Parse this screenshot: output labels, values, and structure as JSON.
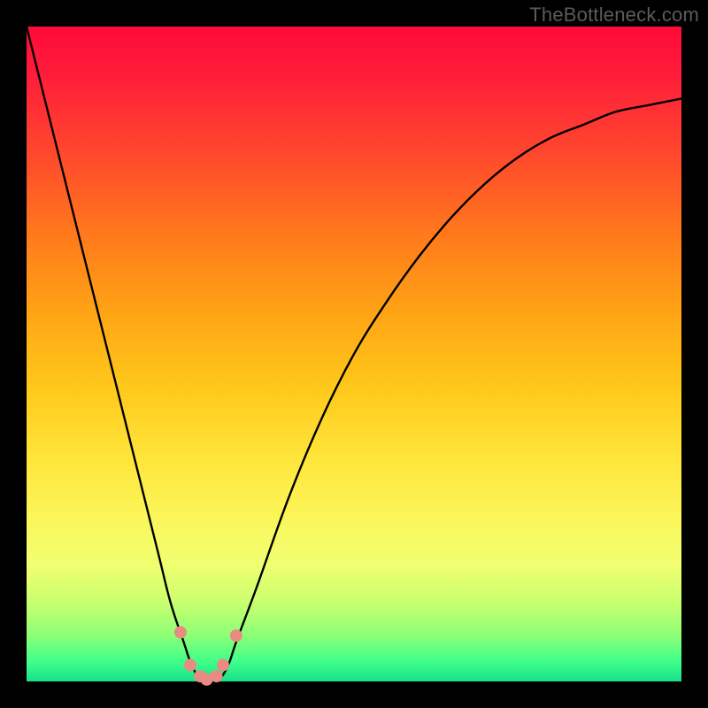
{
  "watermark": "TheBottleneck.com",
  "chart_data": {
    "type": "line",
    "title": "",
    "xlabel": "",
    "ylabel": "",
    "xlim": [
      0,
      100
    ],
    "ylim": [
      0,
      100
    ],
    "x": [
      0,
      5,
      10,
      15,
      20,
      22,
      24,
      25,
      26,
      27,
      28,
      29,
      30,
      31,
      32,
      35,
      40,
      45,
      50,
      55,
      60,
      65,
      70,
      75,
      80,
      85,
      90,
      95,
      100
    ],
    "values": [
      100,
      80,
      60,
      40,
      20,
      12,
      6,
      3,
      1,
      0,
      0,
      0,
      1,
      3,
      6,
      14,
      28,
      40,
      50,
      58,
      65,
      71,
      76,
      80,
      83,
      85,
      87,
      88,
      89
    ],
    "minimum_x": 27.5,
    "marker_points_x": [
      23.5,
      25.0,
      26.5,
      27.5,
      29.0,
      30.0,
      32.0
    ],
    "marker_points_y": [
      7.5,
      2.5,
      0.8,
      0.3,
      0.8,
      2.5,
      7.0
    ],
    "gradient_stops": [
      {
        "pos": 0.0,
        "color": "#ff0a3a"
      },
      {
        "pos": 0.5,
        "color": "#ffc81a"
      },
      {
        "pos": 0.8,
        "color": "#f1ff70"
      },
      {
        "pos": 1.0,
        "color": "#18e08a"
      }
    ]
  }
}
